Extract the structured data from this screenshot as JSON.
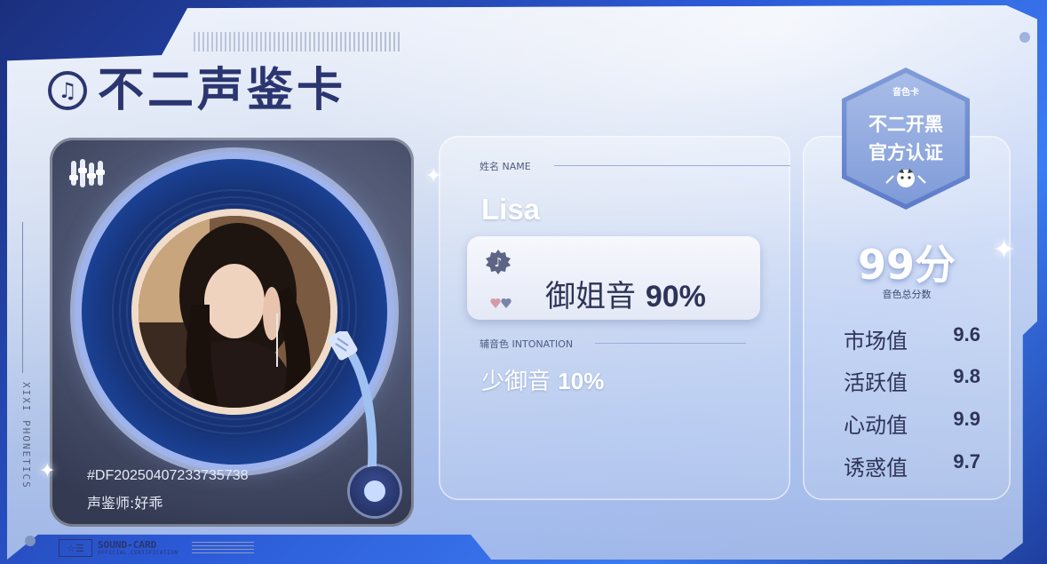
{
  "card": {
    "title": "不二声鉴卡",
    "music_icon": "♫"
  },
  "side": {
    "vertical_text": "XIXI  PHONETICS"
  },
  "player": {
    "card_id": "#DF20250407233735738",
    "appraiser": "声鉴师:好乖"
  },
  "profile": {
    "name_label": "姓名 NAME",
    "name": "Lisa",
    "primary_voice_name": "御姐音",
    "primary_voice_pct": "90%",
    "secondary_label": "辅音色 INTONATION",
    "secondary_voice_name": "少御音",
    "secondary_voice_pct": "10%"
  },
  "badge": {
    "top": "音色卡",
    "line1": "不二开黑",
    "line2": "官方认证"
  },
  "score": {
    "total": "99分",
    "total_label": "音色总分数",
    "metrics": [
      {
        "label": "市场值",
        "value": "9.6"
      },
      {
        "label": "活跃值",
        "value": "9.8"
      },
      {
        "label": "心动值",
        "value": "9.9"
      },
      {
        "label": "诱惑值",
        "value": "9.7"
      }
    ]
  },
  "footer": {
    "logo_icon": "☆☰",
    "logo_main": "SOUND-CARD",
    "logo_sub": "OFFICIAL CERTIFICATION"
  },
  "colors": {
    "frame_blue": "#2b59d6",
    "title_navy": "#2b3570",
    "player_dark": "#4d5571"
  },
  "icons": [
    "music-note-icon",
    "equalizer-icon",
    "vinyl-disc-icon",
    "tonearm-icon",
    "voice-badge-icon",
    "hearts-icon",
    "mascot-icon",
    "sparkle-icon"
  ]
}
